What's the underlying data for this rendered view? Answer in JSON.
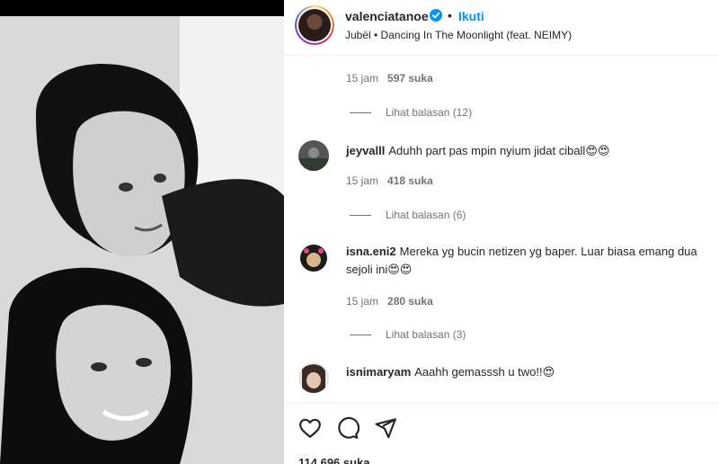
{
  "header": {
    "username": "valenciatanoe",
    "follow_label": "Ikuti",
    "separator": "•",
    "audio": "Jubël • Dancing In The Moonlight (feat. NEIMY)"
  },
  "comments": [
    {
      "meta_time": "15 jam",
      "meta_likes": "597 suka",
      "replies": "Lihat balasan (12)"
    },
    {
      "username": "jeyvalll",
      "text": "Aduhh part pas mpin nyium jidat ciball😍😍",
      "meta_time": "15 jam",
      "meta_likes": "418 suka",
      "replies": "Lihat balasan (6)"
    },
    {
      "username": "isna.eni2",
      "text": "Mereka yg bucin netizen yg baper. Luar biasa emang dua sejoli ini😍😍",
      "meta_time": "15 jam",
      "meta_likes": "280 suka",
      "replies": "Lihat balasan (3)"
    },
    {
      "username": "isnimaryam",
      "text": "Aaahh gemasssh u two!!😍"
    }
  ],
  "actions": {
    "likes_total": "114.696 suka",
    "icons": [
      "heart-icon",
      "comment-icon",
      "share-icon"
    ]
  },
  "colors": {
    "link_blue": "#0095f6",
    "muted": "#737373",
    "text": "#262626"
  }
}
